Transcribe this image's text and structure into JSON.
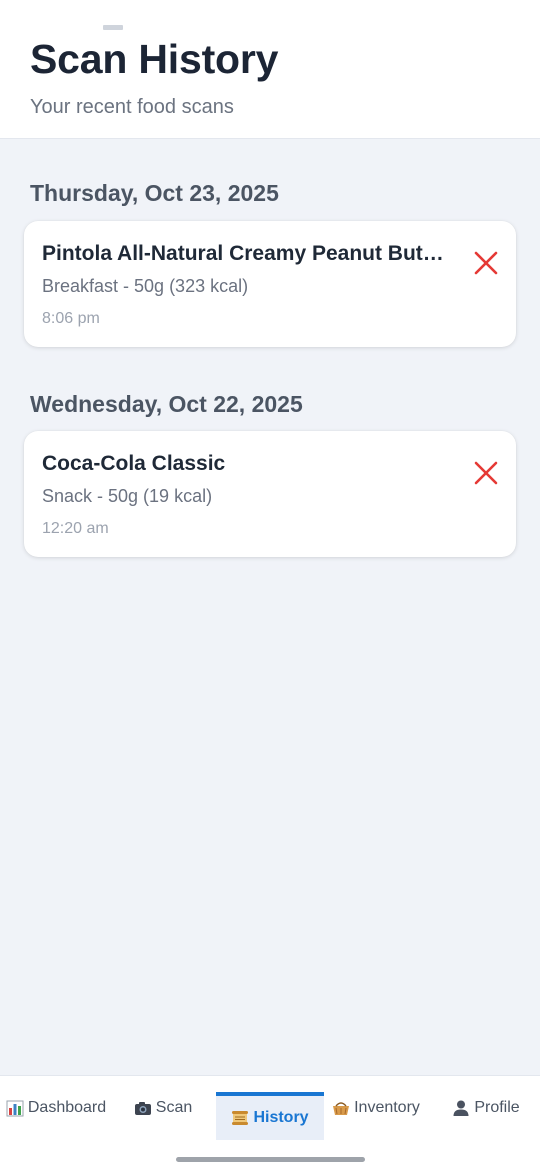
{
  "header": {
    "title": "Scan History",
    "subtitle": "Your recent food scans"
  },
  "groups": [
    {
      "date": "Thursday, Oct 23, 2025",
      "items": [
        {
          "name": "Pintola All-Natural Creamy Peanut Butter",
          "detail": "Breakfast - 50g (323 kcal)",
          "time": "8:06 pm"
        }
      ]
    },
    {
      "date": "Wednesday, Oct 22, 2025",
      "items": [
        {
          "name": "Coca-Cola Classic",
          "detail": "Snack - 50g (19 kcal)",
          "time": "12:20 am"
        }
      ]
    }
  ],
  "nav": {
    "items": [
      {
        "label": "Dashboard",
        "icon": "bar-chart-icon"
      },
      {
        "label": "Scan",
        "icon": "camera-icon"
      },
      {
        "label": "History",
        "icon": "scroll-icon",
        "active": true
      },
      {
        "label": "Inventory",
        "icon": "basket-icon"
      },
      {
        "label": "Profile",
        "icon": "person-icon"
      }
    ]
  },
  "colors": {
    "accent": "#1976d2",
    "delete": "#e53935",
    "background": "#f0f3f8"
  }
}
